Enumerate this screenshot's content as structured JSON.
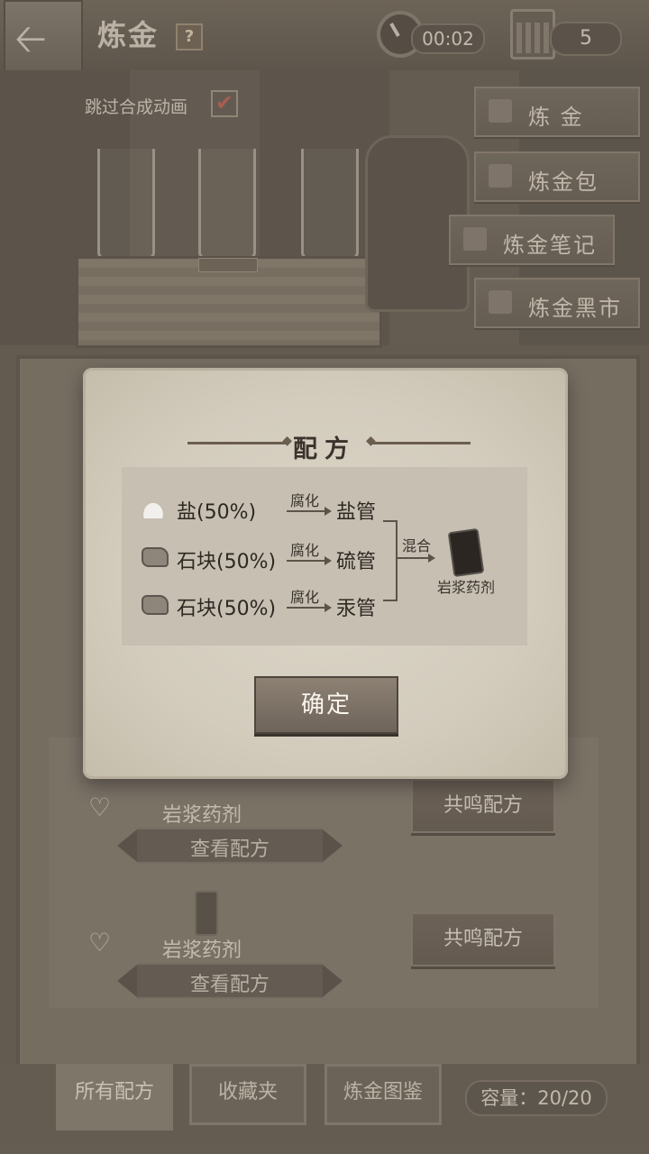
{
  "header": {
    "title": "炼金",
    "help": "?",
    "timer": "00:02",
    "day_count": "5"
  },
  "scene": {
    "skip_label": "跳过合成动画",
    "skip_checked": true
  },
  "side_menu": [
    {
      "label": "炼 金",
      "icon": "cauldron-icon"
    },
    {
      "label": "炼金包",
      "icon": "bag-icon"
    },
    {
      "label": "炼金笔记",
      "icon": "book-icon"
    },
    {
      "label": "炼金黑市",
      "icon": "house-icon"
    }
  ],
  "recipes": [
    {
      "name": "岩浆药剂",
      "view": "查看配方",
      "resonate": "共鸣配方"
    },
    {
      "name": "岩浆药剂",
      "view": "查看配方",
      "resonate": "共鸣配方"
    }
  ],
  "tabs": {
    "all": "所有配方",
    "favorites": "收藏夹",
    "codex": "炼金图鉴"
  },
  "capacity": "容量：20/20",
  "dialog": {
    "title": "配方",
    "ingredients": [
      {
        "name": "盐(50%)",
        "process": "腐化",
        "product": "盐管"
      },
      {
        "name": "石块(50%)",
        "process": "腐化",
        "product": "硫管"
      },
      {
        "name": "石块(50%)",
        "process": "腐化",
        "product": "汞管"
      }
    ],
    "mix_label": "混合",
    "result": "岩浆药剂",
    "confirm": "确定"
  }
}
